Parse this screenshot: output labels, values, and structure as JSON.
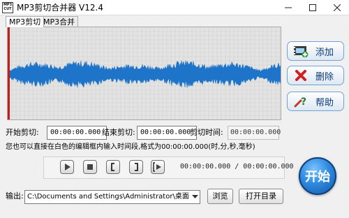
{
  "window": {
    "title": "MP3剪切合并器 V12.4",
    "logo_top": "MP3",
    "logo_bottom": "CUT"
  },
  "tabs": [
    {
      "label": "MP3剪切"
    },
    {
      "label": "MP3合并"
    }
  ],
  "side_buttons": {
    "add": "添加",
    "delete": "删除",
    "help": "帮助"
  },
  "time": {
    "start_label": "开始剪切:",
    "start_value": "00:00:00.000",
    "end_label": "结束剪切:",
    "end_value": "00:00:00.000",
    "cut_label": "剪切时间:",
    "cut_value": "00:00:00.000"
  },
  "hint": "您也可以直接在白色的编辑框内输入时间段,格式为00:00:00.000(时,分,秒,毫秒)",
  "player": {
    "position": "00:00:00.000 / 00:00:00.000"
  },
  "start_button": "开始",
  "output": {
    "label": "输出:",
    "path": "C:\\Documents and Settings\\Administrator\\桌面",
    "browse": "浏览",
    "open_dir": "打开目录"
  },
  "colors": {
    "accent": "#1457a6",
    "button_text": "#0b3d7a",
    "waveform": "#1e74c8",
    "marker": "#c0201c"
  }
}
